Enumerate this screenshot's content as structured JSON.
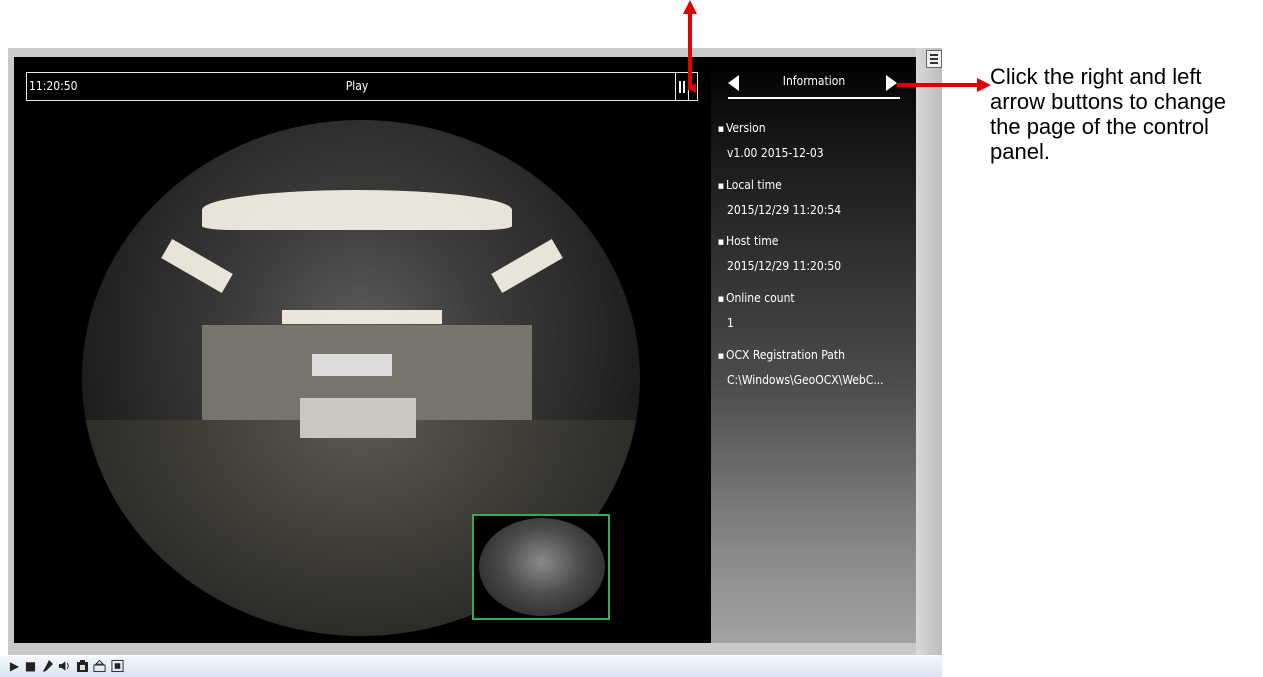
{
  "osd": {
    "time": "11:20:50",
    "state": "Play"
  },
  "panel": {
    "title": "Information",
    "items": [
      {
        "label": "Version",
        "value": "v1.00  2015-12-03"
      },
      {
        "label": "Local time",
        "value": "2015/12/29 11:20:54"
      },
      {
        "label": "Host time",
        "value": "2015/12/29 11:20:50"
      },
      {
        "label": "Online count",
        "value": "1"
      },
      {
        "label": "OCX Registration Path",
        "value": "C:\\Windows\\GeoOCX\\WebC..."
      }
    ]
  },
  "toolbar": {
    "icons": [
      "play-icon",
      "stop-icon",
      "microphone-icon",
      "speaker-icon",
      "snapshot-icon",
      "record-icon",
      "fullscreen-icon"
    ]
  },
  "annotation": {
    "callout_text": "Click the right and left arrow buttons to change the page of the control panel.",
    "color": "#e00000"
  },
  "colors": {
    "video_bg": "#000000",
    "pip_border": "#2fae5a",
    "toolbar_bg": "#dde7f3"
  }
}
